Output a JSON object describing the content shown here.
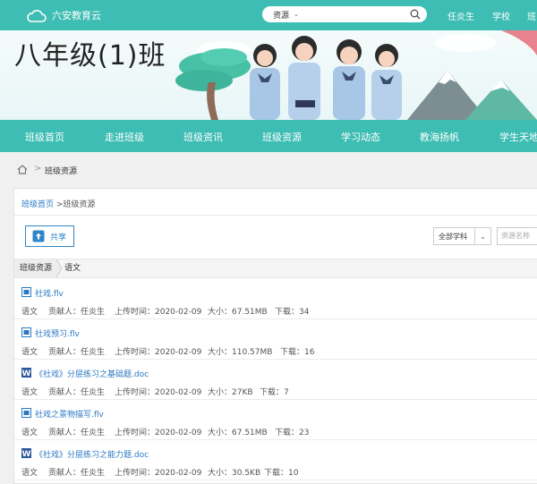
{
  "header": {
    "logo_text": "六安教育云",
    "search": {
      "selected": "资源"
    },
    "nav": [
      {
        "label": "任炎生"
      },
      {
        "label": "学校"
      },
      {
        "label": "班"
      }
    ]
  },
  "banner": {
    "class_name": "八年级(1)班"
  },
  "navbar": {
    "items": [
      {
        "label": "班级首页"
      },
      {
        "label": "走进班级"
      },
      {
        "label": "班级资讯"
      },
      {
        "label": "班级资源"
      },
      {
        "label": "学习动态"
      },
      {
        "label": "教海扬帆"
      },
      {
        "label": "学生天地"
      }
    ]
  },
  "breadcrumb": {
    "separator": ">",
    "current": "班级资源"
  },
  "panel": {
    "path_home": "班级首页",
    "path_sep": " >",
    "path_current": "班级资源",
    "share_label": "共享",
    "subject_filter": "全部学科",
    "name_placeholder": "资源名称",
    "tabs": [
      "班级资源",
      "语文"
    ]
  },
  "resources": [
    {
      "type": "video",
      "name": "社戏.flv",
      "subject": "语文",
      "contributor": "贡献人：任炎生",
      "upload": "上传时间：2020-02-09",
      "size": "大小：67.51MB",
      "downloads": "下载：34"
    },
    {
      "type": "video",
      "name": "社戏预习.flv",
      "subject": "语文",
      "contributor": "贡献人：任炎生",
      "upload": "上传时间：2020-02-09",
      "size": "大小：110.57MB",
      "downloads": "下载：16"
    },
    {
      "type": "word",
      "name": "《社戏》分层练习之基础题.doc",
      "subject": "语文",
      "contributor": "贡献人：任炎生",
      "upload": "上传时间：2020-02-09",
      "size": "大小：27KB",
      "downloads": "下载：7"
    },
    {
      "type": "video",
      "name": "社戏之景物描写.flv",
      "subject": "语文",
      "contributor": "贡献人：任炎生",
      "upload": "上传时间：2020-02-09",
      "size": "大小：67.51MB",
      "downloads": "下载：23"
    },
    {
      "type": "word",
      "name": "《社戏》分层练习之能力题.doc",
      "subject": "语文",
      "contributor": "贡献人：任炎生",
      "upload": "上传时间：2020-02-09",
      "size": "大小：30.5KB",
      "downloads": "下载：10"
    }
  ],
  "colors": {
    "teal": "#3dbdb3",
    "link": "#2a78c4",
    "word_blue": "#2b579a"
  },
  "icons": {
    "logo": "cloud-icon",
    "search": "search-icon",
    "home": "home-icon",
    "share": "upload-icon",
    "video": "video-file-icon",
    "word": "word-file-icon"
  }
}
